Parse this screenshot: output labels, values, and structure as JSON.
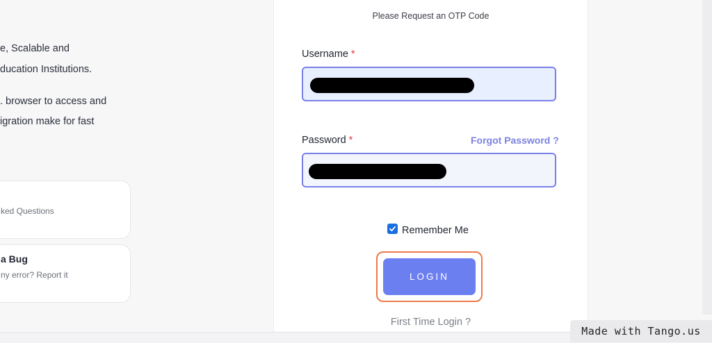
{
  "intro": {
    "line1": "e, Scalable and",
    "line2": "ducation Institutions.",
    "line3": ". browser to access and",
    "line4": "igration make for fast"
  },
  "cards": [
    {
      "title": "",
      "subtitle": "ked Questions"
    },
    {
      "title": "a Bug",
      "subtitle": "ny error? Report it"
    }
  ],
  "form": {
    "otp_prompt": "Please Request an OTP Code",
    "username_label": "Username",
    "password_label": "Password",
    "required_mark": "*",
    "forgot_password": "Forgot Password ?",
    "remember_me": "Remember Me",
    "remember_checked": true,
    "login_button": "LOGIN",
    "first_time_login": "First Time Login ?"
  },
  "watermark": "Made with Tango.us",
  "colors": {
    "accent": "#6c7ff0",
    "highlight": "#ec7a4b",
    "required": "#e23b3b"
  }
}
